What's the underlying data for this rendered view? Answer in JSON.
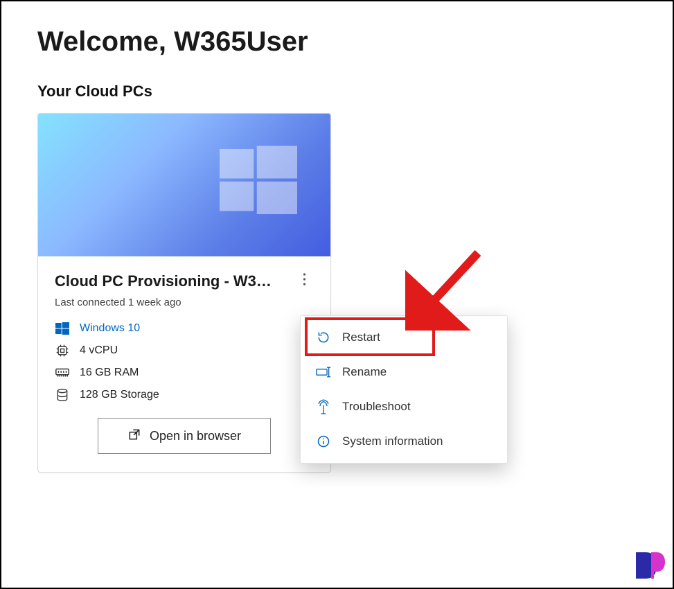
{
  "header": {
    "welcome": "Welcome, W365User"
  },
  "section": {
    "title": "Your Cloud PCs"
  },
  "card": {
    "title": "Cloud PC Provisioning - W3…",
    "last_connected": "Last connected 1 week ago",
    "os": "Windows 10",
    "cpu": "4 vCPU",
    "ram": "16 GB RAM",
    "storage": "128 GB Storage",
    "open_label": "Open in browser"
  },
  "menu": {
    "restart": "Restart",
    "rename": "Rename",
    "troubleshoot": "Troubleshoot",
    "system_info": "System information"
  }
}
